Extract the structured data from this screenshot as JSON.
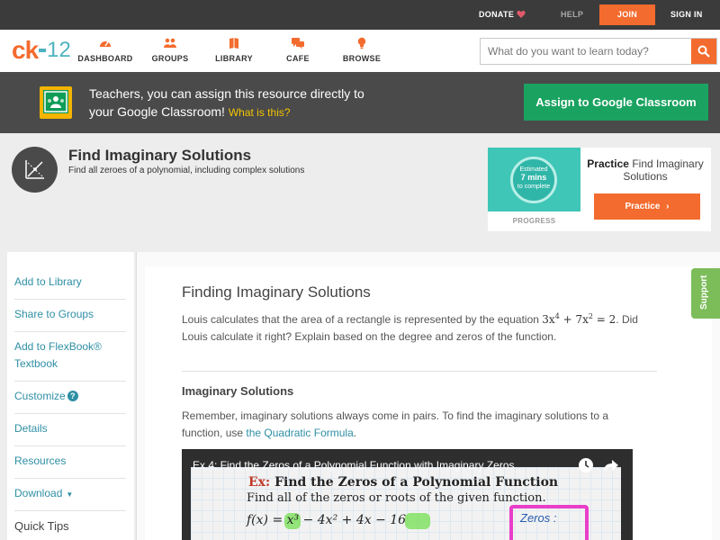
{
  "topbar": {
    "donate": "DONATE",
    "help": "HELP",
    "join": "JOIN",
    "signin": "SIGN IN",
    "colors": {
      "bar": "#3b3b3b",
      "accent": "#f36b2e"
    }
  },
  "nav": {
    "logo": {
      "left": "ck",
      "right": "12"
    },
    "items": [
      {
        "label": "DASHBOARD",
        "icon": "dashboard-icon"
      },
      {
        "label": "GROUPS",
        "icon": "groups-icon"
      },
      {
        "label": "LIBRARY",
        "icon": "library-icon"
      },
      {
        "label": "CAFE",
        "icon": "cafe-icon"
      },
      {
        "label": "BROWSE",
        "icon": "browse-icon"
      }
    ],
    "search_placeholder": "What do you want to learn today?"
  },
  "google_banner": {
    "line1": "Teachers, you can assign this resource directly to",
    "line2": "your Google Classroom!",
    "what": "What is this?",
    "button": "Assign to Google Classroom"
  },
  "header": {
    "title": "Find Imaginary Solutions",
    "subtitle": "Find all zeroes of a polynomial, including complex solutions"
  },
  "practice_card": {
    "estimated": "Estimated",
    "mins": "7 mins",
    "to_complete": "to complete",
    "progress": "PROGRESS",
    "label_bold": "Practice",
    "label_rest": "Find Imaginary Solutions",
    "button": "Practice"
  },
  "sidebar": {
    "items": [
      {
        "label": "Add to Library"
      },
      {
        "label": "Share to Groups"
      },
      {
        "label": "Add to FlexBook® Textbook"
      },
      {
        "label": "Customize"
      },
      {
        "label": "Details"
      },
      {
        "label": "Resources"
      },
      {
        "label": "Download"
      }
    ],
    "help": "?",
    "tips": "Quick Tips"
  },
  "content": {
    "section_title": "Finding Imaginary Solutions",
    "para1_a": "Louis calculates that the area of a rectangle is represented by the equation",
    "para1_b": ". Did",
    "para1_c": "Louis calculate it right? Explain based on the degree and zeros of the function.",
    "sub_title": "Imaginary Solutions",
    "para2_a": "Remember, imaginary solutions always come in pairs. To find the imaginary solutions to a",
    "para2_b": "function, use",
    "para2_link": "the Quadratic Formula",
    "para2_c": "."
  },
  "video": {
    "title": "Ex 4: Find the Zeros of a Polynomial Function with Imaginary Zeros",
    "ex_label": "Ex:",
    "ex_text": "Find the Zeros of a Polynomial Function",
    "find": "Find all of the zeros or roots of the given function.",
    "fx": "f(x) = x³ − 4x² + 4x − 16",
    "zeros": "Zeros :"
  },
  "support": "Support"
}
